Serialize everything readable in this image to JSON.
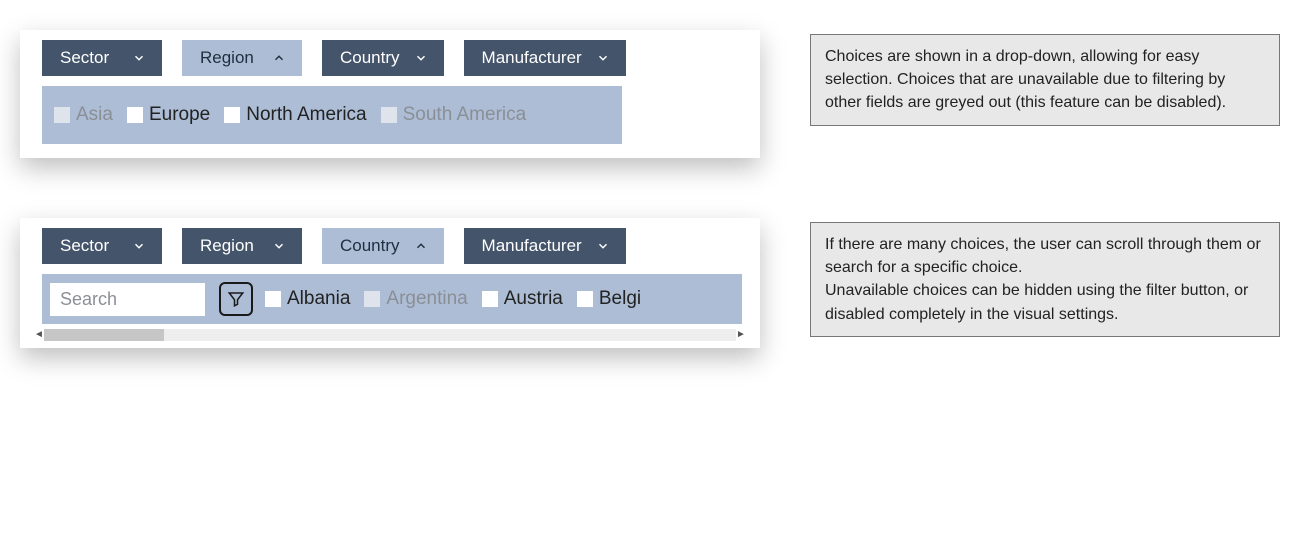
{
  "example1": {
    "filters": [
      {
        "label": "Sector",
        "active": false
      },
      {
        "label": "Region",
        "active": true
      },
      {
        "label": "Country",
        "active": false
      },
      {
        "label": "Manufacturer",
        "active": false
      }
    ],
    "choices": [
      {
        "label": "Asia",
        "enabled": false
      },
      {
        "label": "Europe",
        "enabled": true
      },
      {
        "label": "North America",
        "enabled": true
      },
      {
        "label": "South America",
        "enabled": false
      }
    ],
    "caption": "Choices are shown in a drop-down, allowing for easy selection. Choices that are unavailable due to filtering by other fields are greyed out (this feature can be disabled)."
  },
  "example2": {
    "filters": [
      {
        "label": "Sector",
        "active": false
      },
      {
        "label": "Region",
        "active": false
      },
      {
        "label": "Country",
        "active": true
      },
      {
        "label": "Manufacturer",
        "active": false
      }
    ],
    "search_placeholder": "Search",
    "choices": [
      {
        "label": "Albania",
        "enabled": true
      },
      {
        "label": "Argentina",
        "enabled": false
      },
      {
        "label": "Austria",
        "enabled": true
      },
      {
        "label": "Belgi",
        "enabled": true
      }
    ],
    "caption": "If there are many choices, the user can scroll through them or search for a specific choice.\nUnavailable choices can be hidden using the filter button, or disabled completely in the visual settings."
  }
}
